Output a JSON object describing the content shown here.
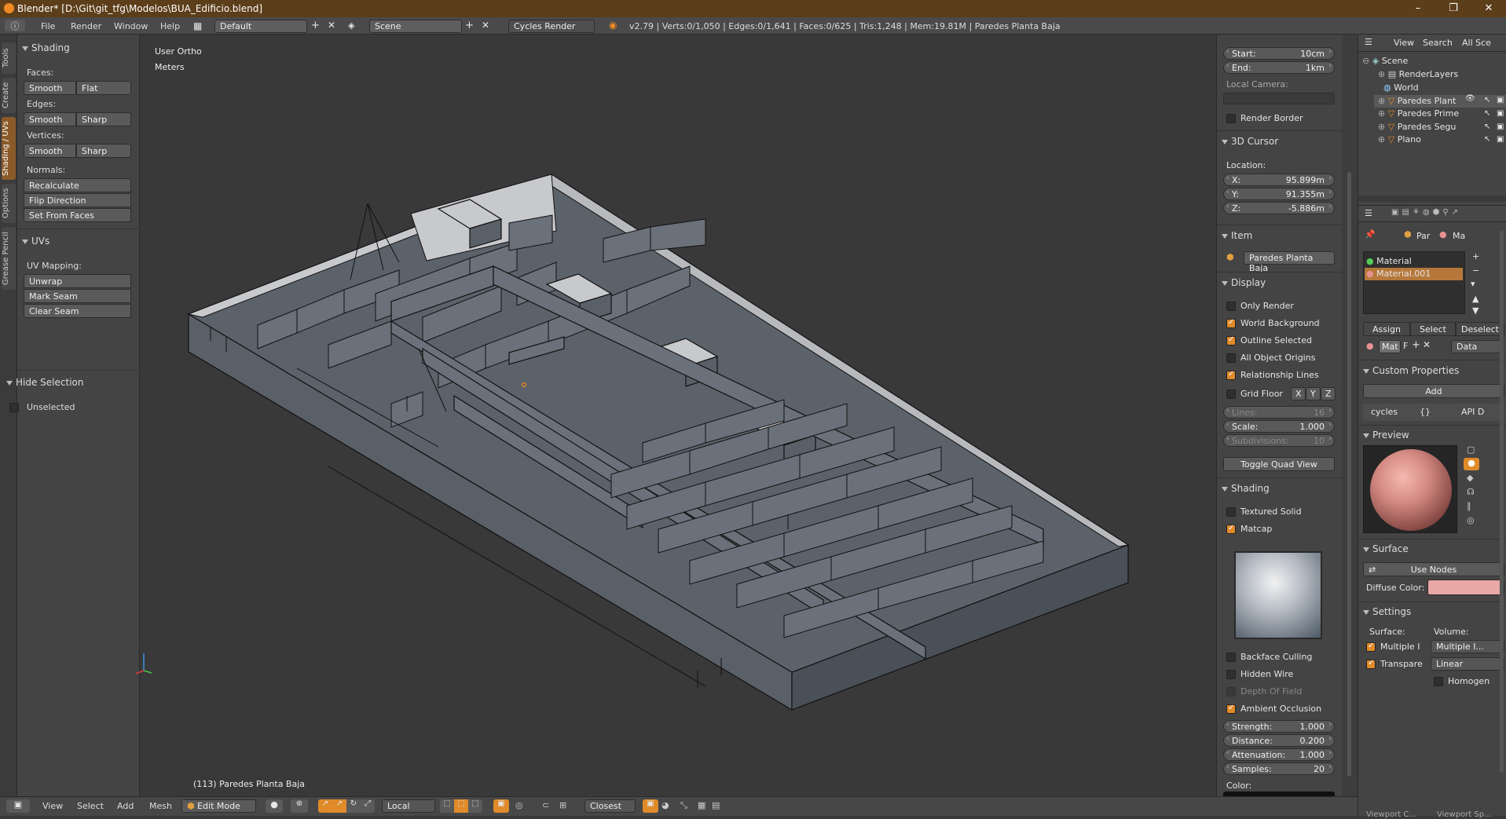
{
  "window": {
    "title": "Blender* [D:\\Git\\git_tfg\\Modelos\\BUA_Edificio.blend]",
    "minimize": "–",
    "maximize": "❐",
    "close": "✕"
  },
  "menubar": {
    "info_icon": "info-icon",
    "items": [
      "File",
      "Render",
      "Window",
      "Help"
    ],
    "layout": "Default",
    "scene": "Scene",
    "engine": "Cycles Render",
    "stats": "v2.79 | Verts:0/1,050 | Edges:0/1,641 | Faces:0/625 | Tris:1,248 | Mem:19.81M | Paredes Planta Baja"
  },
  "vtabs": [
    "Tools",
    "Create",
    "Shading / UVs",
    "Options",
    "Grease Pencil"
  ],
  "toolshelf": {
    "shading_header": "Shading",
    "faces_label": "Faces:",
    "faces_smooth": "Smooth",
    "faces_flat": "Flat",
    "edges_label": "Edges:",
    "edges_smooth": "Smooth",
    "edges_sharp": "Sharp",
    "vertices_label": "Vertices:",
    "vertices_smooth": "Smooth",
    "vertices_sharp": "Sharp",
    "normals_label": "Normals:",
    "recalculate": "Recalculate",
    "flip_direction": "Flip Direction",
    "set_from_faces": "Set From Faces",
    "uvs_header": "UVs",
    "uv_mapping_label": "UV Mapping:",
    "unwrap": "Unwrap",
    "mark_seam": "Mark Seam",
    "clear_seam": "Clear Seam",
    "hide_header": "Hide Selection",
    "unselected": "Unselected"
  },
  "viewport": {
    "view_name": "User Ortho",
    "units": "Meters",
    "object_label": "(113) Paredes Planta Baja"
  },
  "npanel": {
    "start_label": "Start:",
    "start_val": "10cm",
    "end_label": "End:",
    "end_val": "1km",
    "local_camera": "Local Camera:",
    "render_border": "Render Border",
    "cursor_header": "3D Cursor",
    "location": "Location:",
    "x_label": "X:",
    "x_val": "95.899m",
    "y_label": "Y:",
    "y_val": "91.355m",
    "z_label": "Z:",
    "z_val": "-5.886m",
    "item_header": "Item",
    "item_name": "Paredes Planta Baja",
    "display_header": "Display",
    "only_render": "Only Render",
    "world_background": "World Background",
    "outline_selected": "Outline Selected",
    "all_object_origins": "All Object Origins",
    "relationship_lines": "Relationship Lines",
    "grid_floor": "Grid Floor",
    "axis_x": "X",
    "axis_y": "Y",
    "axis_z": "Z",
    "lines_label": "Lines:",
    "lines_val": "16",
    "scale_label": "Scale:",
    "scale_val": "1.000",
    "subdiv_label": "Subdivisions:",
    "subdiv_val": "10",
    "toggle_quad": "Toggle Quad View",
    "shading_header": "Shading",
    "textured_solid": "Textured Solid",
    "matcap": "Matcap",
    "backface_culling": "Backface Culling",
    "hidden_wire": "Hidden Wire",
    "depth_of_field": "Depth Of Field",
    "ambient_occlusion": "Ambient Occlusion",
    "strength_label": "Strength:",
    "strength_val": "1.000",
    "distance_label": "Distance:",
    "distance_val": "0.200",
    "attenuation_label": "Attenuation:",
    "attenuation_val": "1.000",
    "samples_label": "Samples:",
    "samples_val": "20",
    "color_label": "Color:"
  },
  "outliner": {
    "view": "View",
    "search": "Search",
    "all_scenes": "All Sce",
    "items": [
      "Scene",
      "RenderLayers",
      "World",
      "Paredes Plant",
      "Paredes Prime",
      "Paredes Segu",
      "Plano"
    ]
  },
  "properties": {
    "par_tab": "Par",
    "ma_tab": "Ma",
    "materials": [
      "Material",
      "Material.001"
    ],
    "assign": "Assign",
    "select": "Select",
    "deselect": "Deselect",
    "mat_field": "Mat",
    "f_label": "F",
    "data": "Data",
    "custom_props": "Custom Properties",
    "add": "Add",
    "cycles": "cycles",
    "braces": "{}",
    "api": "API D",
    "preview": "Preview",
    "surface": "Surface",
    "use_nodes": "Use Nodes",
    "diffuse_color": "Diffuse Color:",
    "settings": "Settings",
    "surface_label": "Surface:",
    "volume_label": "Volume:",
    "multiple_i": "Multiple I",
    "multiple_i2": "Multiple I...",
    "transpare": "Transpare",
    "linear": "Linear",
    "homogen": "Homogen",
    "bottom_left": "Viewport C...",
    "bottom_right": "Viewport Sp..."
  },
  "bottombar": {
    "view": "View",
    "select": "Select",
    "add": "Add",
    "mesh": "Mesh",
    "mode": "Edit Mode",
    "pivot": "Local",
    "snap": "Closest"
  },
  "colors": {
    "accent": "#e08a2a",
    "diffuse": "#e8a8a4",
    "selected_row": "#b5783a"
  }
}
